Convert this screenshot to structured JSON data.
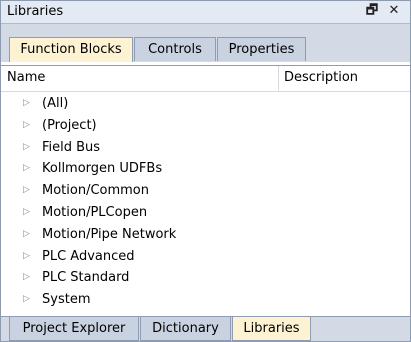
{
  "panel": {
    "title": "Libraries",
    "float_icon": "float-window-icon",
    "close_icon": "close-icon",
    "float_glyph": "🗗",
    "close_glyph": "✕"
  },
  "top_tabs": [
    {
      "label": "Function Blocks",
      "active": true
    },
    {
      "label": "Controls",
      "active": false
    },
    {
      "label": "Properties",
      "active": false
    }
  ],
  "columns": {
    "name": "Name",
    "description": "Description"
  },
  "tree_items": [
    {
      "label": "(All)"
    },
    {
      "label": "(Project)"
    },
    {
      "label": "Field Bus"
    },
    {
      "label": "Kollmorgen UDFBs"
    },
    {
      "label": "Motion/Common"
    },
    {
      "label": "Motion/PLCopen"
    },
    {
      "label": "Motion/Pipe Network"
    },
    {
      "label": "PLC Advanced"
    },
    {
      "label": "PLC Standard"
    },
    {
      "label": "System"
    }
  ],
  "expander_glyph": "▷",
  "bottom_tabs": [
    {
      "label": "Project Explorer",
      "active": false
    },
    {
      "label": "Dictionary",
      "active": false
    },
    {
      "label": "Libraries",
      "active": true
    }
  ],
  "colors": {
    "active_tab": "#fdf3d3",
    "inactive_tab": "#c9d2e0",
    "tab_strip": "#d3dae6",
    "title_bar": "#e4eaf3"
  }
}
